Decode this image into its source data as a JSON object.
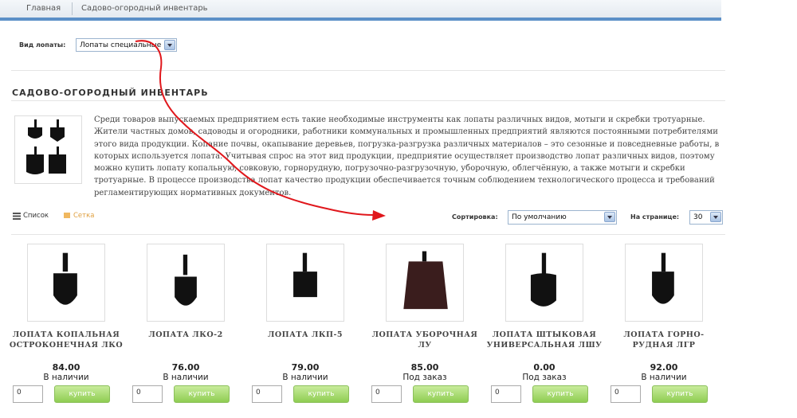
{
  "breadcrumb": [
    "Главная",
    "Садово-огородный инвентарь"
  ],
  "filter": {
    "label": "Вид лопаты:",
    "value": "Лопаты специальные"
  },
  "section": {
    "title": "САДОВО-ОГОРОДНЫЙ ИНВЕНТАРЬ",
    "description": "Среди товаров выпускаемых предприятием есть такие необходимые инструменты как лопаты различных видов, мотыги и скребки тротуарные. Жители частных домов, садоводы и огородники, работники коммунальных и промышленных предприятий являются постоянными потребителями этого вида продукции. Копание почвы, окапывание деревьев, погрузка-разгрузка различных материалов – это сезонные и повседневные работы, в которых используется лопата. Учитывая спрос на этот вид продукции, предприятие осуществляет производство лопат различных видов, поэтому можно купить лопату копальную, совковую, горнорудную, погрузочно-разгрузочную, уборочную, облегчённую, а также мотыги и скребки тротуарные. В процессе производства лопат качество продукции обеспечивается точным соблюдением технологического процесса и требований регламентирующих нормативных документов."
  },
  "view": {
    "list_label": "Список",
    "grid_label": "Сетка"
  },
  "sort": {
    "label": "Сортировка:",
    "value": "По умолчанию"
  },
  "per_page": {
    "label": "На странице:",
    "value": "30"
  },
  "products": [
    {
      "name": "ЛОПАТА КОПАЛЬНАЯ ОСТРОКОНЕЧНАЯ ЛКО",
      "price": "84.00",
      "availability": "В наличии",
      "qty": "0",
      "buy": "купить"
    },
    {
      "name": "ЛОПАТА ЛКО-2",
      "price": "76.00",
      "availability": "В наличии",
      "qty": "0",
      "buy": "купить"
    },
    {
      "name": "ЛОПАТА ЛКП-5",
      "price": "79.00",
      "availability": "В наличии",
      "qty": "0",
      "buy": "купить"
    },
    {
      "name": "ЛОПАТА УБОРОЧНАЯ ЛУ",
      "price": "85.00",
      "availability": "Под заказ",
      "qty": "0",
      "buy": "купить"
    },
    {
      "name": "ЛОПАТА ШТЫКОВАЯ УНИВЕРСАЛЬНАЯ ЛШУ",
      "price": "0.00",
      "availability": "Под заказ",
      "qty": "0",
      "buy": "купить"
    },
    {
      "name": "ЛОПАТА ГОРНО-РУДНАЯ ЛГР",
      "price": "92.00",
      "availability": "В наличии",
      "qty": "0",
      "buy": "купить"
    }
  ],
  "colors": {
    "accent": "#5b8fc7",
    "buy_button": "#8fcd52",
    "annotation_arrow": "#e0171c"
  }
}
